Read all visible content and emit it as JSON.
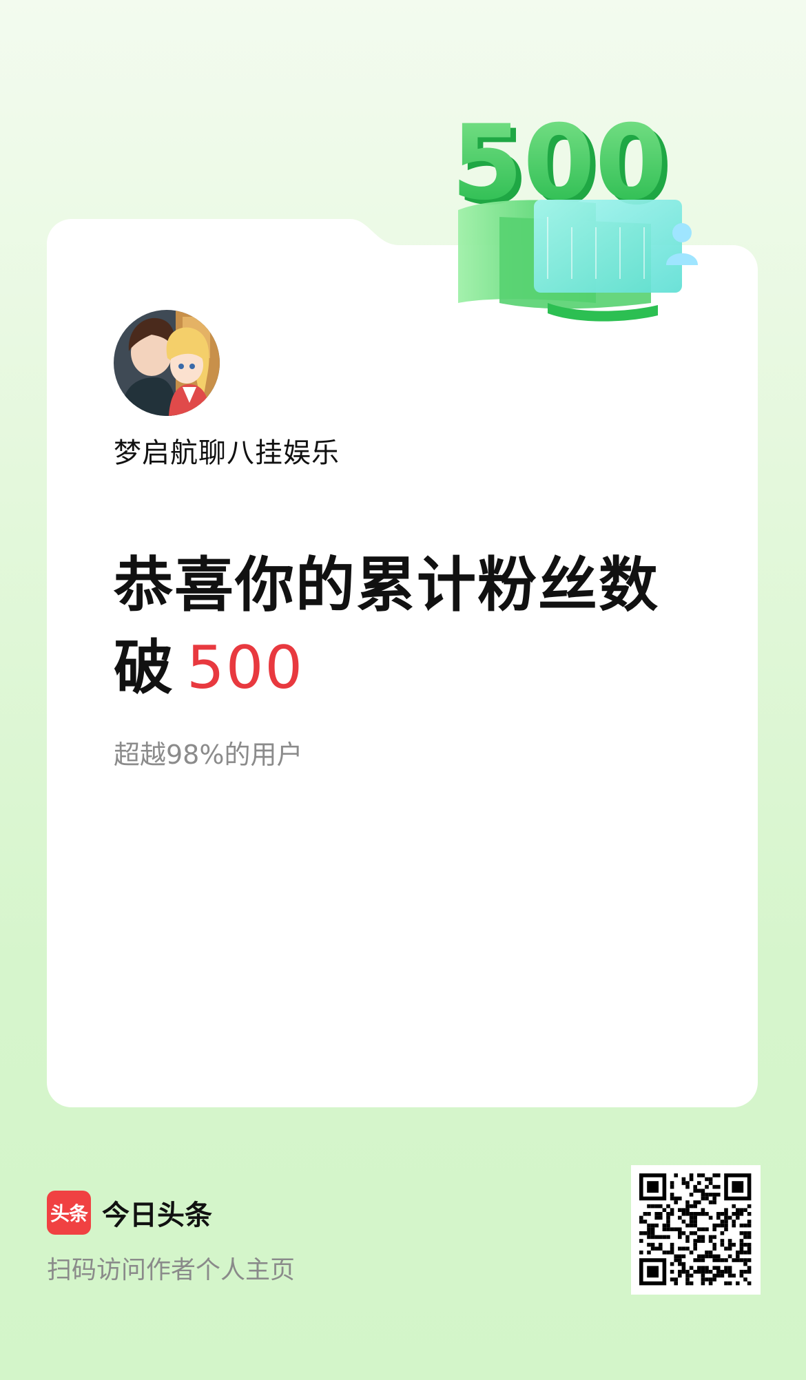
{
  "author": {
    "name": "梦启航聊八挂娱乐",
    "avatar_icon": "anime-couple-avatar"
  },
  "milestone": {
    "badge_number": "500",
    "headline_line1": "恭喜你的累计粉丝数",
    "headline_line2_prefix": "破",
    "headline_number": "500",
    "subtext": "超越98%的用户"
  },
  "footer": {
    "logo_text": "头条",
    "brand_name": "今日头条",
    "caption": "扫码访问作者个人主页"
  },
  "colors": {
    "accent_red": "#e8393f",
    "brand_red": "#f04142",
    "badge_green": "#3ccb5f",
    "background_green": "#d6f5cc"
  }
}
